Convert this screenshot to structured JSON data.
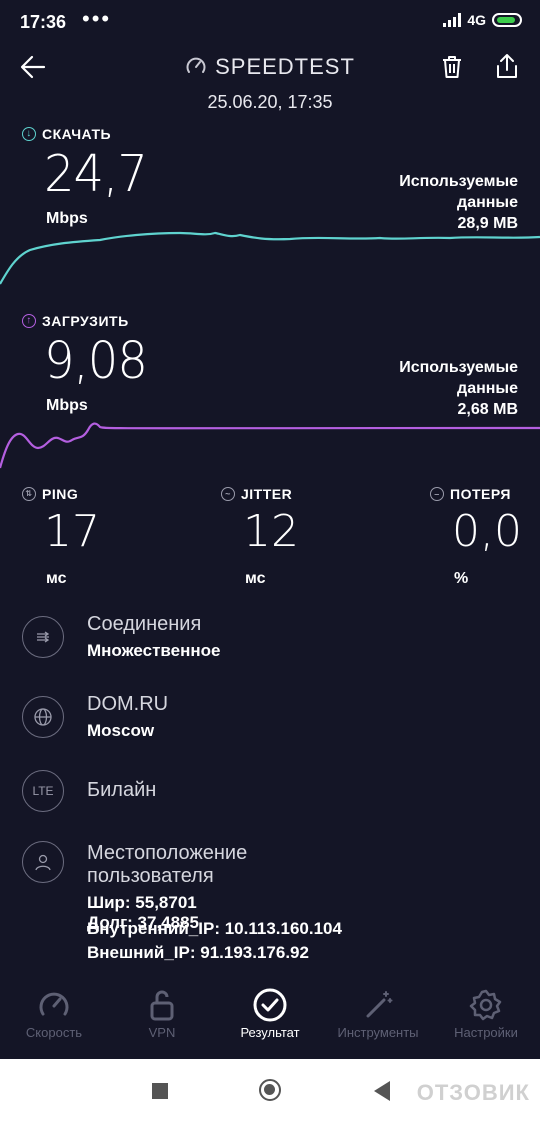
{
  "status": {
    "time": "17:36",
    "dots": "•••",
    "network": "4G"
  },
  "header": {
    "title": "SPEEDTEST",
    "date": "25.06.20, 17:35"
  },
  "download": {
    "label": "СКАЧАТЬ",
    "value": "24,7",
    "unit": "Mbps",
    "used_line1": "Используемые",
    "used_line2": "данные",
    "used_value": "28,9 MB",
    "color": "#5fd3cf"
  },
  "upload": {
    "label": "ЗАГРУЗИТЬ",
    "value": "9,08",
    "unit": "Mbps",
    "used_line1": "Используемые",
    "used_line2": "данные",
    "used_value": "2,68 MB",
    "color": "#b45fe0"
  },
  "ping": {
    "label": "PING",
    "value": "17",
    "unit": "мс"
  },
  "jitter": {
    "label": "JITTER",
    "value": "12",
    "unit": "мс"
  },
  "loss": {
    "label": "ПОТЕРЯ",
    "value": "0,0",
    "unit": "%"
  },
  "connections": {
    "title": "Соединения",
    "value": "Множественное"
  },
  "provider": {
    "title": "DOM.RU",
    "value": "Moscow"
  },
  "carrier": {
    "icon_text": "LTE",
    "title": "Билайн"
  },
  "location": {
    "title": "Местоположение пользователя",
    "coords": "Шир: 55,8701 Долг: 37,4885"
  },
  "ip": {
    "internal": "Внутренний_IP: 10.113.160.104",
    "external": "Внешний_IP: 91.193.176.92"
  },
  "nav": {
    "speed": "Скорость",
    "vpn": "VPN",
    "result": "Результат",
    "tools": "Инструменты",
    "settings": "Настройки"
  },
  "watermark": "ОТЗОВИК"
}
